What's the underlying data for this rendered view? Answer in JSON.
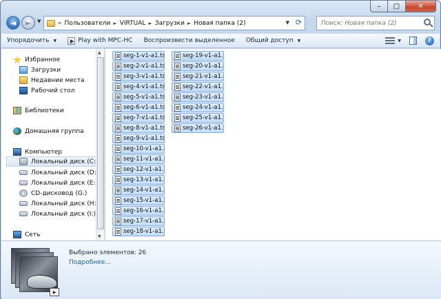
{
  "window": {
    "buttons": {
      "minimize": "–",
      "maximize": "□",
      "close": "✕"
    }
  },
  "address_bar": {
    "breadcrumbs": [
      "Пользователи",
      "VIRTUAL",
      "Загрузки",
      "Новая папка (2)"
    ],
    "overflow_glyph": "«"
  },
  "search": {
    "placeholder": "Поиск: Новая папка (2)"
  },
  "toolbar": {
    "organize": "Упорядочить",
    "play": "Play with MPC-HC",
    "play_selected": "Воспроизвести выделенное",
    "share": "Общий доступ",
    "help": "?"
  },
  "nav_pane": {
    "favorites": "Избранное",
    "downloads": "Загрузки",
    "recent": "Недавние места",
    "desktop": "Рабочий стол",
    "libraries": "Библиотеки",
    "homegroup": "Домашняя группа",
    "computer": "Компьютер",
    "drives": [
      "Локальный диск (C:)",
      "Локальный диск (D:)",
      "Локальный диск (E:)",
      "CD-дисковод (G:)",
      "Локальный диск (H:)",
      "Локальный диск (I:)"
    ],
    "network": "Сеть"
  },
  "files": [
    "seg-1-v1-a1.ts",
    "seg-2-v1-a1.ts",
    "seg-3-v1-a1.ts",
    "seg-4-v1-a1.ts",
    "seg-5-v1-a1.ts",
    "seg-6-v1-a1.ts",
    "seg-7-v1-a1.ts",
    "seg-8-v1-a1.ts",
    "seg-9-v1-a1.ts",
    "seg-10-v1-a1.ts",
    "seg-11-v1-a1.ts",
    "seg-12-v1-a1.ts",
    "seg-13-v1-a1.ts",
    "seg-14-v1-a1.ts",
    "seg-15-v1-a1.ts",
    "seg-16-v1-a1.ts",
    "seg-17-v1-a1.ts",
    "seg-18-v1-a1.ts",
    "seg-19-v1-a1.ts",
    "seg-20-v1-a1.ts",
    "seg-21-v1-a1.ts",
    "seg-22-v1-a1.ts",
    "seg-23-v1-a1.ts",
    "seg-24-v1-a1.ts",
    "seg-25-v1-a1.ts",
    "seg-26-v1-a1.ts"
  ],
  "details": {
    "selected_count": "Выбрано элементов: 26",
    "more_link": "Подробнее..."
  }
}
